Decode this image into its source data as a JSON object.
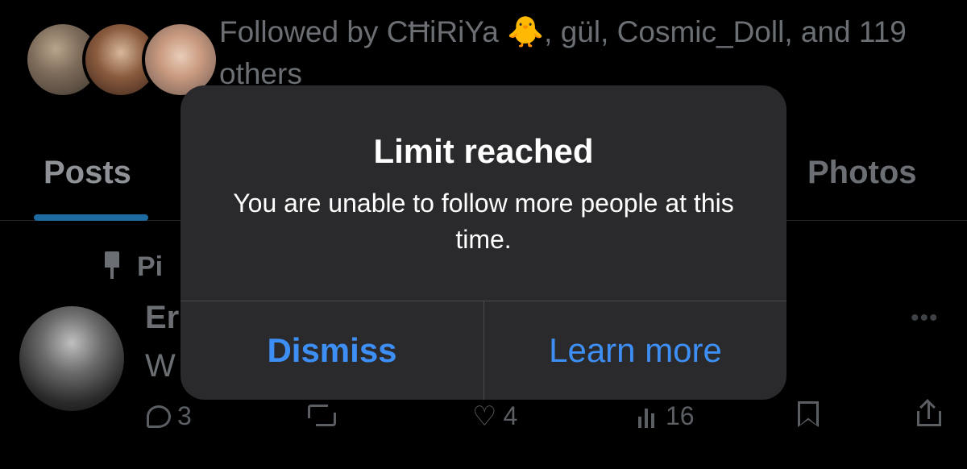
{
  "profile": {
    "followed_by": "Followed by CĦiRiYa 🐥, gül, Cosmic_Doll, and 119 others"
  },
  "tabs": {
    "posts": "Posts",
    "photos": "Photos"
  },
  "post": {
    "pinned_label": "Pi",
    "author_partial": "Er",
    "text_partial": "W",
    "more": "•••",
    "reply_count": "3",
    "like_count": "4",
    "views_count": "16"
  },
  "alert": {
    "title": "Limit reached",
    "message": "You are unable to follow more people at this time.",
    "dismiss_label": "Dismiss",
    "learn_more_label": "Learn more"
  },
  "colors": {
    "accent": "#3e8ff5",
    "dialog_bg": "#2a2a2c",
    "tab_underline": "#1d6aa0"
  }
}
